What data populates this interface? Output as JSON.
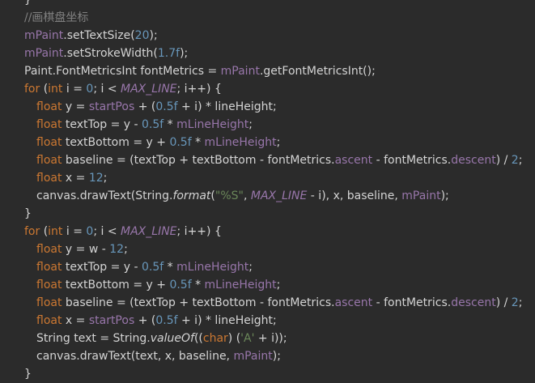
{
  "editor": {
    "lines": [
      {
        "tokens": [
          {
            "t": "}",
            "c": "p"
          }
        ]
      },
      {
        "tokens": [
          {
            "t": "//画棋盘坐标",
            "c": "cmt"
          }
        ]
      },
      {
        "tokens": [
          {
            "t": "mPaint",
            "c": "fld"
          },
          {
            "t": ".setTextSize(",
            "c": "p"
          },
          {
            "t": "20",
            "c": "num"
          },
          {
            "t": ");",
            "c": "p"
          }
        ]
      },
      {
        "tokens": [
          {
            "t": "mPaint",
            "c": "fld"
          },
          {
            "t": ".setStrokeWidth(",
            "c": "p"
          },
          {
            "t": "1.7f",
            "c": "num"
          },
          {
            "t": ");",
            "c": "p"
          }
        ]
      },
      {
        "tokens": [
          {
            "t": "Paint.FontMetricsInt fontMetrics = ",
            "c": "p"
          },
          {
            "t": "mPaint",
            "c": "fld"
          },
          {
            "t": ".getFontMetricsInt();",
            "c": "p"
          }
        ]
      },
      {
        "tokens": [
          {
            "t": "for ",
            "c": "kw"
          },
          {
            "t": "(",
            "c": "p"
          },
          {
            "t": "int ",
            "c": "kw"
          },
          {
            "t": "i = ",
            "c": "p"
          },
          {
            "t": "0",
            "c": "num"
          },
          {
            "t": "; i < ",
            "c": "p"
          },
          {
            "t": "MAX_LINE",
            "c": "fld ital"
          },
          {
            "t": "; i++) {",
            "c": "p"
          }
        ]
      },
      {
        "indent": 1,
        "tokens": [
          {
            "t": "float ",
            "c": "kw"
          },
          {
            "t": "y = ",
            "c": "p"
          },
          {
            "t": "startPos",
            "c": "fld"
          },
          {
            "t": " + (",
            "c": "p"
          },
          {
            "t": "0.5f",
            "c": "num"
          },
          {
            "t": " + i) * lineHeight;",
            "c": "p"
          }
        ]
      },
      {
        "indent": 1,
        "tokens": [
          {
            "t": "float ",
            "c": "kw"
          },
          {
            "t": "textTop = y - ",
            "c": "p"
          },
          {
            "t": "0.5f",
            "c": "num"
          },
          {
            "t": " * ",
            "c": "p"
          },
          {
            "t": "mLineHeight",
            "c": "fld"
          },
          {
            "t": ";",
            "c": "p"
          }
        ]
      },
      {
        "indent": 1,
        "tokens": [
          {
            "t": "float ",
            "c": "kw"
          },
          {
            "t": "textBottom = y + ",
            "c": "p"
          },
          {
            "t": "0.5f",
            "c": "num"
          },
          {
            "t": " * ",
            "c": "p"
          },
          {
            "t": "mLineHeight",
            "c": "fld"
          },
          {
            "t": ";",
            "c": "p"
          }
        ]
      },
      {
        "indent": 1,
        "tokens": [
          {
            "t": "float ",
            "c": "kw"
          },
          {
            "t": "baseline = (textTop + textBottom - fontMetrics.",
            "c": "p"
          },
          {
            "t": "ascent",
            "c": "fld"
          },
          {
            "t": " - fontMetrics.",
            "c": "p"
          },
          {
            "t": "descent",
            "c": "fld"
          },
          {
            "t": ") / ",
            "c": "p"
          },
          {
            "t": "2",
            "c": "num"
          },
          {
            "t": ";",
            "c": "p"
          }
        ]
      },
      {
        "indent": 1,
        "tokens": [
          {
            "t": "float ",
            "c": "kw"
          },
          {
            "t": "x = ",
            "c": "p"
          },
          {
            "t": "12",
            "c": "num"
          },
          {
            "t": ";",
            "c": "p"
          }
        ]
      },
      {
        "indent": 1,
        "tokens": [
          {
            "t": "canvas.drawText(String.",
            "c": "p"
          },
          {
            "t": "format",
            "c": "p ital"
          },
          {
            "t": "(",
            "c": "p"
          },
          {
            "t": "\"%S\"",
            "c": "str"
          },
          {
            "t": ", ",
            "c": "p"
          },
          {
            "t": "MAX_LINE",
            "c": "fld ital"
          },
          {
            "t": " - i), x, baseline, ",
            "c": "p"
          },
          {
            "t": "mPaint",
            "c": "fld"
          },
          {
            "t": ");",
            "c": "p"
          }
        ]
      },
      {
        "tokens": [
          {
            "t": "}",
            "c": "p"
          }
        ]
      },
      {
        "tokens": [
          {
            "t": "for ",
            "c": "kw"
          },
          {
            "t": "(",
            "c": "p"
          },
          {
            "t": "int ",
            "c": "kw"
          },
          {
            "t": "i = ",
            "c": "p"
          },
          {
            "t": "0",
            "c": "num"
          },
          {
            "t": "; i < ",
            "c": "p"
          },
          {
            "t": "MAX_LINE",
            "c": "fld ital"
          },
          {
            "t": "; i++) {",
            "c": "p"
          }
        ]
      },
      {
        "indent": 1,
        "tokens": [
          {
            "t": "float ",
            "c": "kw"
          },
          {
            "t": "y = w - ",
            "c": "p"
          },
          {
            "t": "12",
            "c": "num"
          },
          {
            "t": ";",
            "c": "p"
          }
        ]
      },
      {
        "indent": 1,
        "tokens": [
          {
            "t": "float ",
            "c": "kw"
          },
          {
            "t": "textTop = y - ",
            "c": "p"
          },
          {
            "t": "0.5f",
            "c": "num"
          },
          {
            "t": " * ",
            "c": "p"
          },
          {
            "t": "mLineHeight",
            "c": "fld"
          },
          {
            "t": ";",
            "c": "p"
          }
        ]
      },
      {
        "indent": 1,
        "tokens": [
          {
            "t": "float ",
            "c": "kw"
          },
          {
            "t": "textBottom = y + ",
            "c": "p"
          },
          {
            "t": "0.5f",
            "c": "num"
          },
          {
            "t": " * ",
            "c": "p"
          },
          {
            "t": "mLineHeight",
            "c": "fld"
          },
          {
            "t": ";",
            "c": "p"
          }
        ]
      },
      {
        "indent": 1,
        "tokens": [
          {
            "t": "float ",
            "c": "kw"
          },
          {
            "t": "baseline = (textTop + textBottom - fontMetrics.",
            "c": "p"
          },
          {
            "t": "ascent",
            "c": "fld"
          },
          {
            "t": " - fontMetrics.",
            "c": "p"
          },
          {
            "t": "descent",
            "c": "fld"
          },
          {
            "t": ") / ",
            "c": "p"
          },
          {
            "t": "2",
            "c": "num"
          },
          {
            "t": ";",
            "c": "p"
          }
        ]
      },
      {
        "indent": 1,
        "tokens": [
          {
            "t": "float ",
            "c": "kw"
          },
          {
            "t": "x = ",
            "c": "p"
          },
          {
            "t": "startPos",
            "c": "fld"
          },
          {
            "t": " + (",
            "c": "p"
          },
          {
            "t": "0.5f",
            "c": "num"
          },
          {
            "t": " + i) * lineHeight;",
            "c": "p"
          }
        ]
      },
      {
        "indent": 1,
        "tokens": [
          {
            "t": "String text = String.",
            "c": "p"
          },
          {
            "t": "valueOf",
            "c": "p ital"
          },
          {
            "t": "((",
            "c": "p"
          },
          {
            "t": "char",
            "c": "kw"
          },
          {
            "t": ") (",
            "c": "p"
          },
          {
            "t": "'A'",
            "c": "str"
          },
          {
            "t": " + i));",
            "c": "p"
          }
        ]
      },
      {
        "indent": 1,
        "tokens": [
          {
            "t": "canvas.drawText(text, x, baseline, ",
            "c": "p"
          },
          {
            "t": "mPaint",
            "c": "fld"
          },
          {
            "t": ");",
            "c": "p"
          }
        ]
      },
      {
        "tokens": [
          {
            "t": "}",
            "c": "p"
          }
        ]
      }
    ]
  },
  "colors": {
    "background": "#2b2b2b",
    "plain": "#d4d4d4",
    "keyword": "#cc7832",
    "field": "#9876aa",
    "number": "#6897bb",
    "string": "#6a8759",
    "comment": "#808080"
  }
}
